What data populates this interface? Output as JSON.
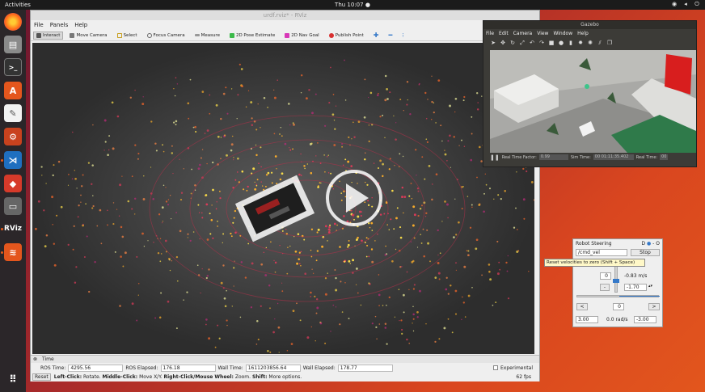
{
  "topbar": {
    "activities": "Activities",
    "clock": "Thu 10:07 ●"
  },
  "dock": {
    "items": [
      "firefox-icon",
      "files-icon",
      "terminal-icon",
      "software-center-icon",
      "text-editor-icon",
      "settings-icon",
      "vscode-icon",
      "git-icon",
      "screen-icon",
      "rviz-icon",
      "layers-icon",
      "app-grid-icon"
    ],
    "rviz_label": "RViz"
  },
  "rviz": {
    "title": "urdf.rviz* - RViz",
    "menu": [
      "File",
      "Panels",
      "Help"
    ],
    "tools": [
      "Interact",
      "Move Camera",
      "Select",
      "Focus Camera",
      "Measure",
      "2D Pose Estimate",
      "2D Nav Goal",
      "Publish Point"
    ],
    "time_panel_title": "Time",
    "time": {
      "ros_time_label": "ROS Time:",
      "ros_time": "4295.56",
      "ros_elapsed_label": "ROS Elapsed:",
      "ros_elapsed": "176.18",
      "wall_time_label": "Wall Time:",
      "wall_time": "1611203856.64",
      "wall_elapsed_label": "Wall Elapsed:",
      "wall_elapsed": "178.77",
      "experimental_label": "Experimental"
    },
    "status": {
      "reset": "Reset",
      "hint_1": "Left-Click:",
      "hint_2": " Rotate. ",
      "hint_3": "Middle-Click:",
      "hint_4": " Move X/Y. ",
      "hint_5": "Right-Click/Mouse Wheel:",
      "hint_6": " Zoom. ",
      "hint_7": "Shift:",
      "hint_8": " More options.",
      "fps": "62 fps"
    }
  },
  "gazebo": {
    "title": "Gazebo",
    "menu": [
      "File",
      "Edit",
      "Camera",
      "View",
      "Window",
      "Help"
    ],
    "stats": {
      "rtf_label": "Real Time Factor:",
      "rtf": "0.99",
      "sim_label": "Sim Time:",
      "sim": "00 01:11:35.402",
      "real_label": "Real Time:",
      "real": "00"
    }
  },
  "steering": {
    "title": "Robot Steering",
    "topic": "/cmd_vel",
    "stop": "Stop",
    "linear_center": "0",
    "linear_value": "-0.83 m/s",
    "linear_max": "-1.70",
    "linear_minus": "-",
    "angular_left": "<",
    "angular_center": "0",
    "angular_right": ">",
    "angular_min": "3.00",
    "angular_value": "0.0 rad/s",
    "angular_max": "-3.00"
  },
  "tooltip": "Reset velocities to zero (Shift + Space)"
}
